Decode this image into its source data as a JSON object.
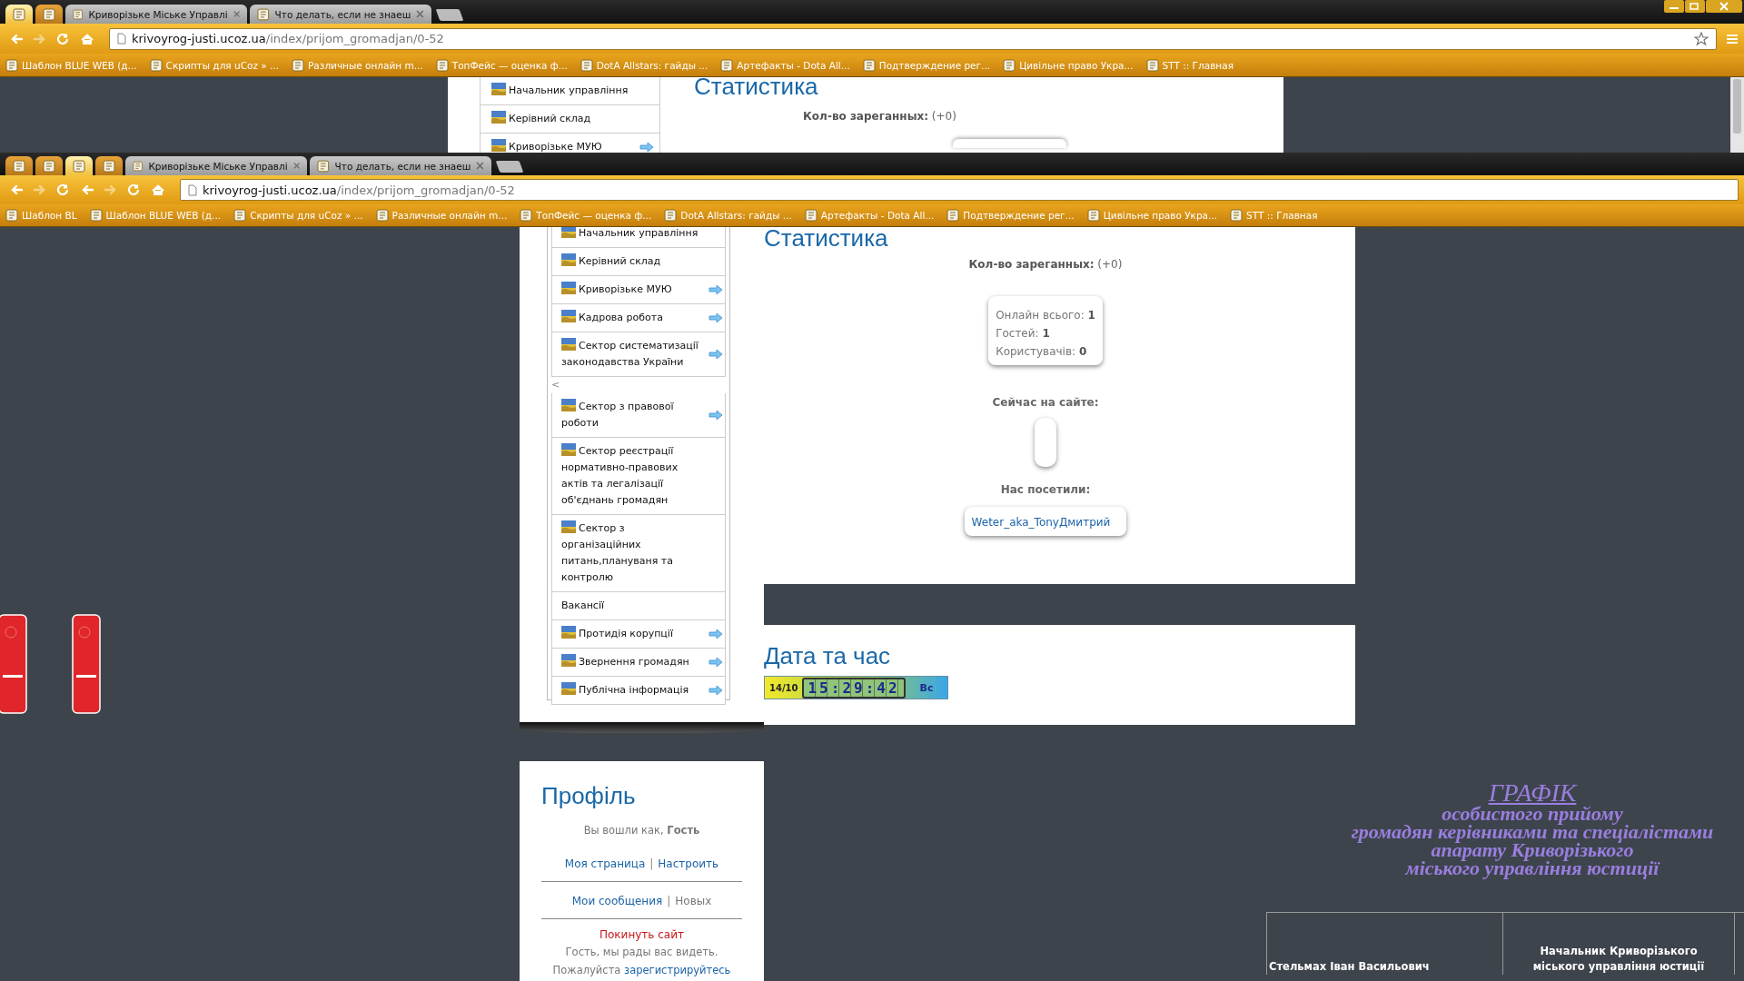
{
  "outer_browser": {
    "window_controls": true,
    "bookmark_star": true,
    "tabs": [
      {
        "kind": "pinned",
        "selected": true
      },
      {
        "kind": "pinned",
        "selected": false
      },
      {
        "kind": "page",
        "title": "Криворізьке Міське Управлі",
        "selected": false
      },
      {
        "kind": "page",
        "title": "Что делать, если не знаеш",
        "selected": false
      }
    ],
    "toolbar_buttons": [
      {
        "kind": "back",
        "disabled": false
      },
      {
        "kind": "forward",
        "disabled": true
      },
      {
        "kind": "reload",
        "disabled": false
      },
      {
        "kind": "home",
        "disabled": false
      }
    ],
    "address": {
      "domain": "krivoyrog-justi.ucoz.ua",
      "path": "/index/prijom_gromadjan/0-52"
    },
    "bookmarks": [
      "Шаблон BLUE WEB (д...",
      "Скрипты для uCoz » ...",
      "Различные онлайн m...",
      "ТопФейс — оценка ф...",
      "DotA Allstars: гайды ...",
      "Артефакты - Dota All...",
      "Подтверждение рег...",
      "Цивільне право Укра...",
      "STT :: Главная"
    ]
  },
  "outer_page": {
    "menu": [
      {
        "label": "Начальник управління",
        "icon": true,
        "submenu": false
      },
      {
        "label": "Керівний склад",
        "icon": true,
        "submenu": false
      },
      {
        "label": "Криворізьке МУЮ",
        "icon": true,
        "submenu": true
      }
    ],
    "heading": "Статистика",
    "registered": {
      "label": "Кол-во зареганных:",
      "value": "(+0)"
    }
  },
  "inner_browser": {
    "window_controls": false,
    "bookmark_star": false,
    "tabs": [
      {
        "kind": "pinned",
        "selected": false
      },
      {
        "kind": "pinned",
        "selected": false
      },
      {
        "kind": "pinned",
        "selected": true
      },
      {
        "kind": "pinned",
        "selected": false
      },
      {
        "kind": "page",
        "title": "Криворізьке Міське Управлі",
        "selected": false
      },
      {
        "kind": "page",
        "title": "Что делать, если не знаеш",
        "selected": false
      }
    ],
    "toolbar_buttons": [
      {
        "kind": "back",
        "disabled": false
      },
      {
        "kind": "forward",
        "disabled": true
      },
      {
        "kind": "reload",
        "disabled": false
      },
      {
        "kind": "back",
        "disabled": false
      },
      {
        "kind": "forward",
        "disabled": true
      },
      {
        "kind": "reload",
        "disabled": false
      },
      {
        "kind": "home",
        "disabled": false
      }
    ],
    "address": {
      "domain": "krivoyrog-justi.ucoz.ua",
      "path": "/index/prijom_gromadjan/0-52"
    },
    "bookmarks": [
      "Шаблон BL",
      "Шаблон BLUE WEB (д...",
      "Скрипты для uCoz » ...",
      "Различные онлайн m...",
      "ТопФейс — оценка ф...",
      "DotA Allstars: гайды ...",
      "Артефакты - Dota All...",
      "Подтверждение рег...",
      "Цивільне право Укра...",
      "STT :: Главная"
    ]
  },
  "page": {
    "side_widgets": [
      {
        "kind": "tab"
      },
      {
        "kind": "tab"
      }
    ],
    "menu": [
      {
        "kind": "item",
        "label": "Начальник управління",
        "icon": true,
        "submenu": false
      },
      {
        "kind": "item",
        "label": "Керівний склад",
        "icon": true,
        "submenu": false
      },
      {
        "kind": "item",
        "label": "Криворізьке МУЮ",
        "icon": true,
        "submenu": true
      },
      {
        "kind": "item",
        "label": "Кадрова робота",
        "icon": true,
        "submenu": true
      },
      {
        "kind": "item",
        "label": "Сектор систематизації законодавства України",
        "icon": true,
        "submenu": true
      },
      {
        "kind": "back",
        "label": "<"
      },
      {
        "kind": "item",
        "label": "Сектор з правової роботи",
        "icon": true,
        "submenu": true
      },
      {
        "kind": "item",
        "label": "Сектор реєстрації нормативно-правових актів та легалізації об'єднань громадян",
        "icon": true,
        "submenu": false
      },
      {
        "kind": "item",
        "label": "Сектор з організаційних питань,плануваня та контролю",
        "icon": true,
        "submenu": false
      },
      {
        "kind": "item",
        "label": "Вакансії",
        "icon": false,
        "submenu": false
      },
      {
        "kind": "item",
        "label": "Протидія корупції",
        "icon": true,
        "submenu": true
      },
      {
        "kind": "item",
        "label": "Звернення громадян",
        "icon": true,
        "submenu": true
      },
      {
        "kind": "item",
        "label": "Публічна інформація",
        "icon": true,
        "submenu": true
      }
    ],
    "stats": {
      "heading": "Статистика",
      "registered": {
        "label": "Кол-во зареганных:",
        "value": "(+0)"
      },
      "online": [
        {
          "label": "Онлайн всього:",
          "value": "1"
        },
        {
          "label": "Гостей:",
          "value": "1"
        },
        {
          "label": "Користувачів:",
          "value": "0"
        }
      ],
      "now_title": "Сейчас на сайте:",
      "visited_title": "Нас посетили:",
      "visitors": [
        "Weter_aka_TonyДмитрий"
      ]
    },
    "date_time": {
      "heading": "Дата та час",
      "date": "14/10",
      "time": "15:29:42",
      "weekday": "Вс"
    },
    "profile": {
      "heading": "Профіль",
      "status": "Вы вошли как, **Гость**",
      "link_rows": [
        {
          "separator": "|",
          "items": [
            {
              "kind": "link",
              "label": "Моя страница"
            },
            {
              "kind": "link",
              "label": "Настроить"
            }
          ]
        },
        {
          "separator": "|",
          "items": [
            {
              "kind": "link",
              "label": "Мои сообщения"
            },
            {
              "kind": "plain",
              "label": "Новых"
            }
          ]
        }
      ],
      "logout": "Покинуть сайт",
      "greeting": "Гость, мы рады вас видеть.",
      "register_prefix": "Пожалуйста",
      "register_link": "зарегистрируйтесь"
    },
    "schedule": {
      "title": "ГРАФІК",
      "subtitle": [
        "особистого прийому",
        "громадян керівниками та спеціалістами",
        "апарату Криворізького",
        "міського управління юстиції"
      ],
      "table": {
        "rows": [
          [
            [
              "Стельмах Іван Васильович"
            ],
            [
              "Начальник Криворізького",
              "міського управління юстиції"
            ]
          ]
        ]
      }
    }
  }
}
